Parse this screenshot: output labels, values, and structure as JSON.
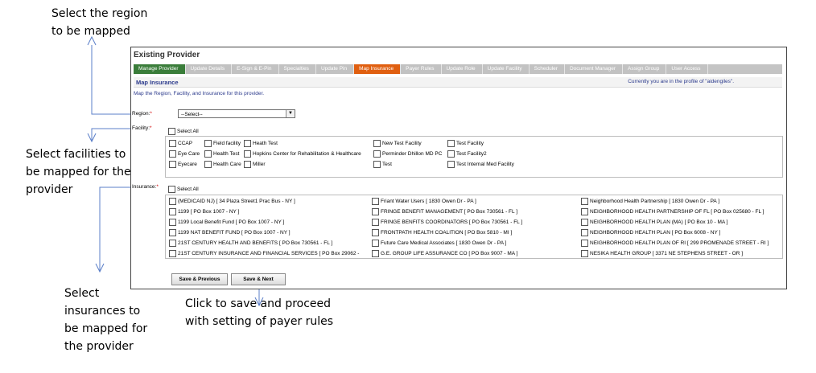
{
  "annotations": {
    "region": "Select the region\nto be mapped",
    "facilities": "Select facilities to\nbe mapped for the\nprovider",
    "insurances": "Select\ninsurances to\nbe mapped for\nthe provider",
    "save_next": "Click to save and proceed\nwith setting of payer rules"
  },
  "window": {
    "title": "Existing Provider"
  },
  "tabs": [
    {
      "label": "Manage Provider",
      "state": "done"
    },
    {
      "label": "Update Details",
      "state": "pending"
    },
    {
      "label": "E-Sign & E-Pin",
      "state": "pending"
    },
    {
      "label": "Specialties",
      "state": "pending"
    },
    {
      "label": "Update Pin",
      "state": "pending"
    },
    {
      "label": "Map Insurance",
      "state": "active"
    },
    {
      "label": "Payer Rules",
      "state": "pending"
    },
    {
      "label": "Update Role",
      "state": "pending"
    },
    {
      "label": "Update Facility",
      "state": "pending"
    },
    {
      "label": "Scheduler",
      "state": "pending"
    },
    {
      "label": "Document Manager",
      "state": "pending"
    },
    {
      "label": "Assign Group",
      "state": "pending"
    },
    {
      "label": "User Access",
      "state": "pending"
    }
  ],
  "section": {
    "title": "Map Insurance",
    "profile_note": "Currently you are in the profile of \"aidengiles\".",
    "intro": "Map the Region, Facility, and Insurance for this provider."
  },
  "region": {
    "label": "Region:",
    "value": "--Select--"
  },
  "facility": {
    "label": "Facility:",
    "select_all": "Select All",
    "items": [
      "CCAP",
      "Field facility",
      "Heath Test",
      "New Test Facility",
      "Test Facility",
      "Eye Care",
      "Health Test",
      "Hopkins Center for Rehabilitation & Healthcare",
      "Perminder Dhillon MD PC",
      "Test Facility2",
      "Eyecare",
      "Health Care",
      "Miller",
      "Test",
      "Test Internal Med Facility"
    ]
  },
  "insurance": {
    "label": "Insurance:",
    "select_all": "Select All",
    "items": [
      "(MEDICAID NJ) [ 34 Plaza Street1 Prac Bus - NY ]",
      "1199 [ PO Box 1007 - NY ]",
      "1199 Local Benefit Fund [ PO Box 1007 - NY ]",
      "1199 NAT BENEFIT FUND [ PO Box 1007 - NY ]",
      "21ST CENTURY HEALTH AND BENEFITS [ PO Box 730561 - FL ]",
      "21ST CENTURY INSURANCE AND FINANCIAL SERVICES [ PO Box 29062 -",
      "Friant Water Users [ 1830 Owen Dr - PA ]",
      "FRINGE BENEFIT MANAGEMENT [ PO Box 730561 - FL ]",
      "FRINGE BENFITS COORDINATORS [ PO Box 730561 - FL ]",
      "FRONTPATH HEALTH COALITION [ PO Box 5810 - MI ]",
      "Future Care Medical Associates [ 1830 Owen Dr - PA ]",
      "G.E. GROUP LIFE ASSURANCE CO [ PO Box 9007 - MA ]",
      "Neighborhood Health Partnership [ 1830 Owen Dr - PA ]",
      "NEIGHBORHOOD HEALTH PARTNERSHIP OF FL [ PO Box 025680 - FL ]",
      "NEIGHBORHOOD HEALTH PLAN (MA) [ PO Box 10 - MA ]",
      "NEIGHBORHOOD HEALTH PLAN [ PO Box 6008 - NY ]",
      "NEIGHBORHOOD HEALTH PLAN OF RI [ 299 PROMENADE STREET - RI ]",
      "NESIKA HEALTH GROUP [ 3371 NE STEPHENS STREET - OR ]"
    ]
  },
  "buttons": {
    "prev": "Save & Previous",
    "next": "Save & Next"
  },
  "colors": {
    "tab_done": "#3a7d3a",
    "tab_active": "#e05f10",
    "tab_pending": "#c2c2c2",
    "link_blue": "#2b3a8c",
    "required": "#d00000"
  }
}
